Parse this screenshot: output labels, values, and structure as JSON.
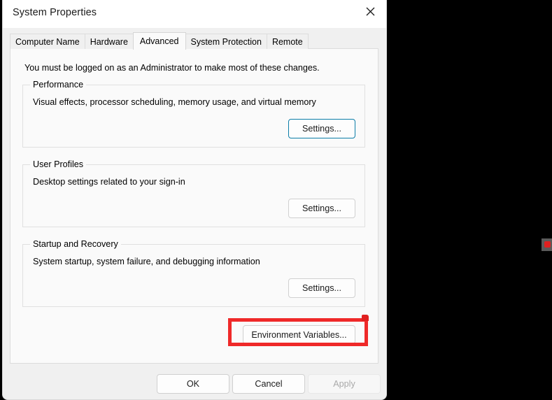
{
  "window": {
    "title": "System Properties",
    "close_icon": "close-icon"
  },
  "tabs": [
    {
      "label": "Computer Name",
      "selected": false
    },
    {
      "label": "Hardware",
      "selected": false
    },
    {
      "label": "Advanced",
      "selected": true
    },
    {
      "label": "System Protection",
      "selected": false
    },
    {
      "label": "Remote",
      "selected": false
    }
  ],
  "panel": {
    "admin_note": "You must be logged on as an Administrator to make most of these changes.",
    "groups": [
      {
        "legend": "Performance",
        "description": "Visual effects, processor scheduling, memory usage, and virtual memory",
        "button_label": "Settings...",
        "focused": true
      },
      {
        "legend": "User Profiles",
        "description": "Desktop settings related to your sign-in",
        "button_label": "Settings...",
        "focused": false
      },
      {
        "legend": "Startup and Recovery",
        "description": "System startup, system failure, and debugging information",
        "button_label": "Settings...",
        "focused": false
      }
    ],
    "environment_variables_label": "Environment Variables..."
  },
  "footer": {
    "ok_label": "OK",
    "cancel_label": "Cancel",
    "apply_label": "Apply"
  },
  "annotation": {
    "target": "Environment Variables...",
    "color": "#ef2929"
  },
  "colors": {
    "accent_focus": "#0b7da8",
    "annotation_red": "#ef2929",
    "window_background": "#f0f0f0",
    "panel_background": "#fafafa",
    "desktop_background": "#000000"
  }
}
